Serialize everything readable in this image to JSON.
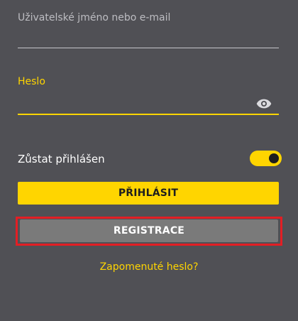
{
  "username": {
    "label": "Uživatelské jméno nebo e-mail",
    "value": ""
  },
  "password": {
    "label": "Heslo",
    "value": "",
    "visibility_icon": "eye-icon"
  },
  "remember": {
    "label": "Zůstat přihlášen",
    "on": true
  },
  "buttons": {
    "login_label": "PŘIHLÁSIT",
    "register_label": "REGISTRACE"
  },
  "forgot_password_label": "Zapomenuté heslo?",
  "colors": {
    "background": "#505055",
    "accent": "#ffd500",
    "register_button": "#7a7a7a",
    "highlight": "#e31e24"
  }
}
